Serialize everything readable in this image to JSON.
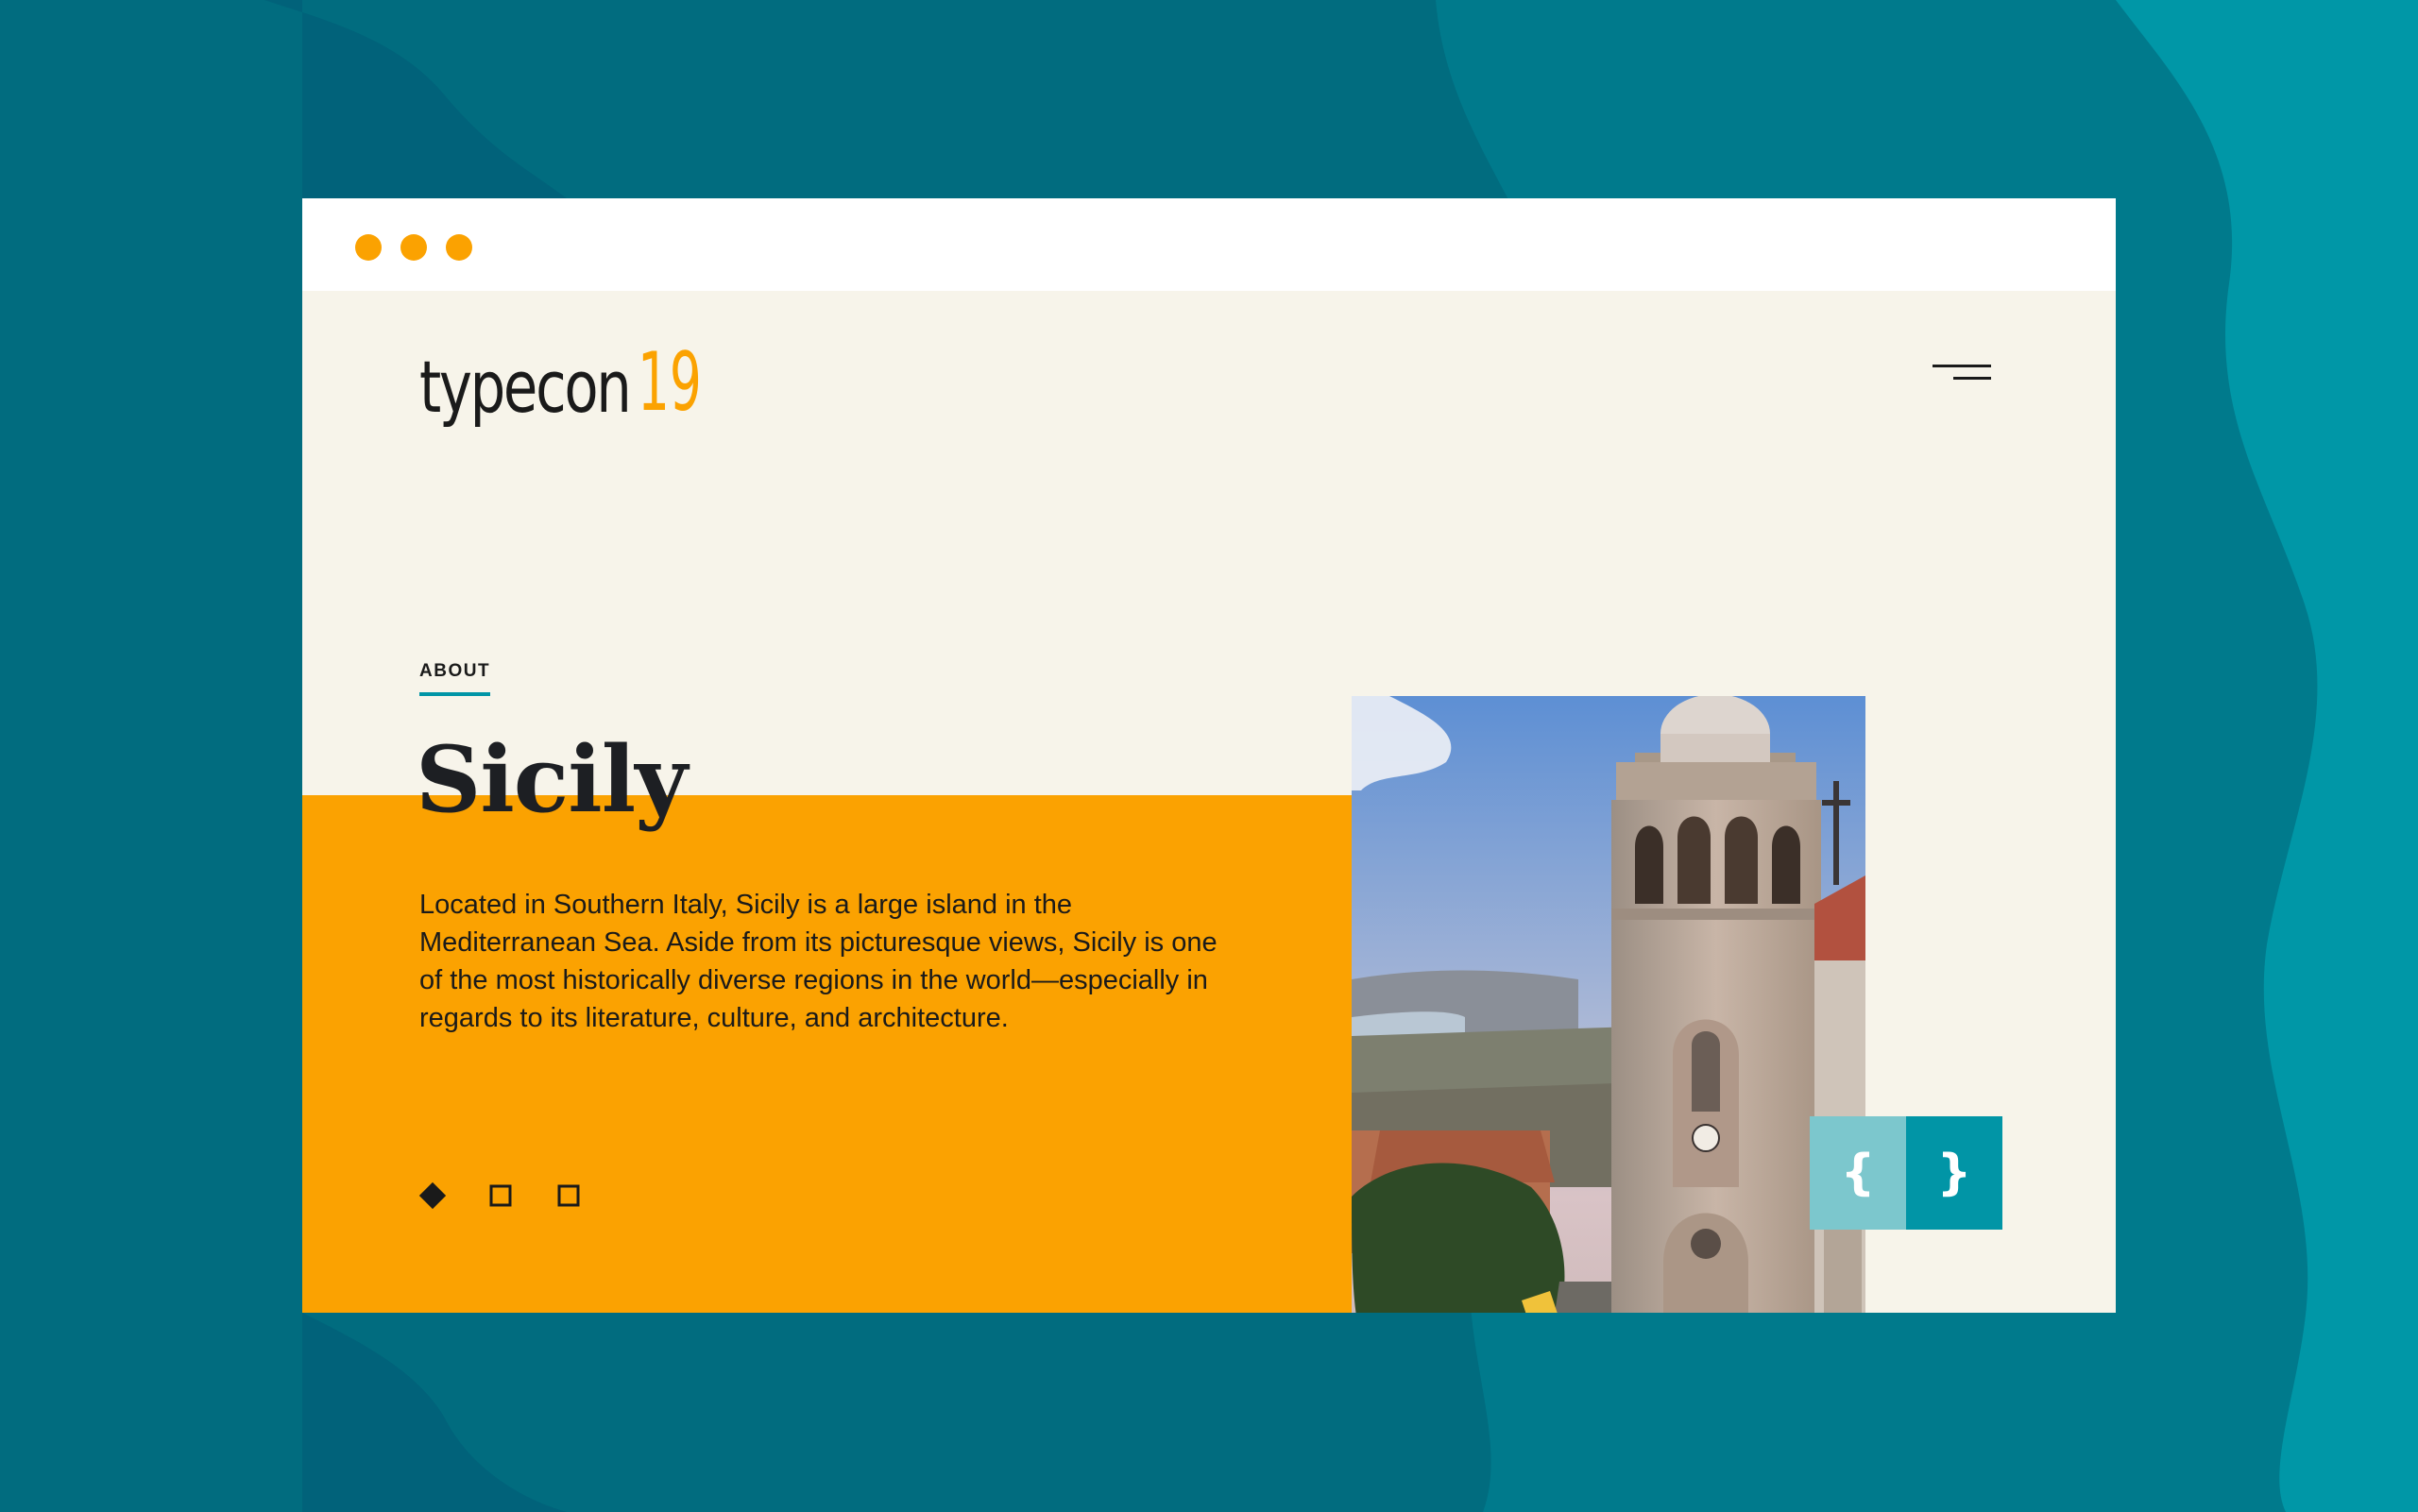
{
  "colors": {
    "background_dark": "#016c7f",
    "background_mid": "#007a8c",
    "background_light": "#0097a7",
    "page_cream": "#f7f4ea",
    "accent_orange": "#fba201",
    "accent_teal": "#0195a6",
    "accent_teal_light": "#7cc7cd",
    "text_dark": "#1a1a1a"
  },
  "window": {
    "controls": [
      "window-dot",
      "window-dot",
      "window-dot"
    ]
  },
  "header": {
    "logo_word": "typecon",
    "logo_number": "19",
    "menu_icon": "hamburger-menu-icon"
  },
  "hero": {
    "section_label": "ABOUT",
    "title": "Sicily",
    "description": "Located in Southern Italy, Sicily is a large island in the Mediterranean Sea. Aside from its picturesque views, Sicily is one of the most historically diverse regions in the world—especially in regards to its literature, culture, and architecture.",
    "photo_icon": "bell-tower-photo"
  },
  "carousel": {
    "prev_label": "{",
    "next_label": "}",
    "pages": [
      {
        "state": "active",
        "icon": "diamond-filled-icon"
      },
      {
        "state": "inactive",
        "icon": "square-outline-icon"
      },
      {
        "state": "inactive",
        "icon": "square-outline-icon"
      }
    ]
  }
}
